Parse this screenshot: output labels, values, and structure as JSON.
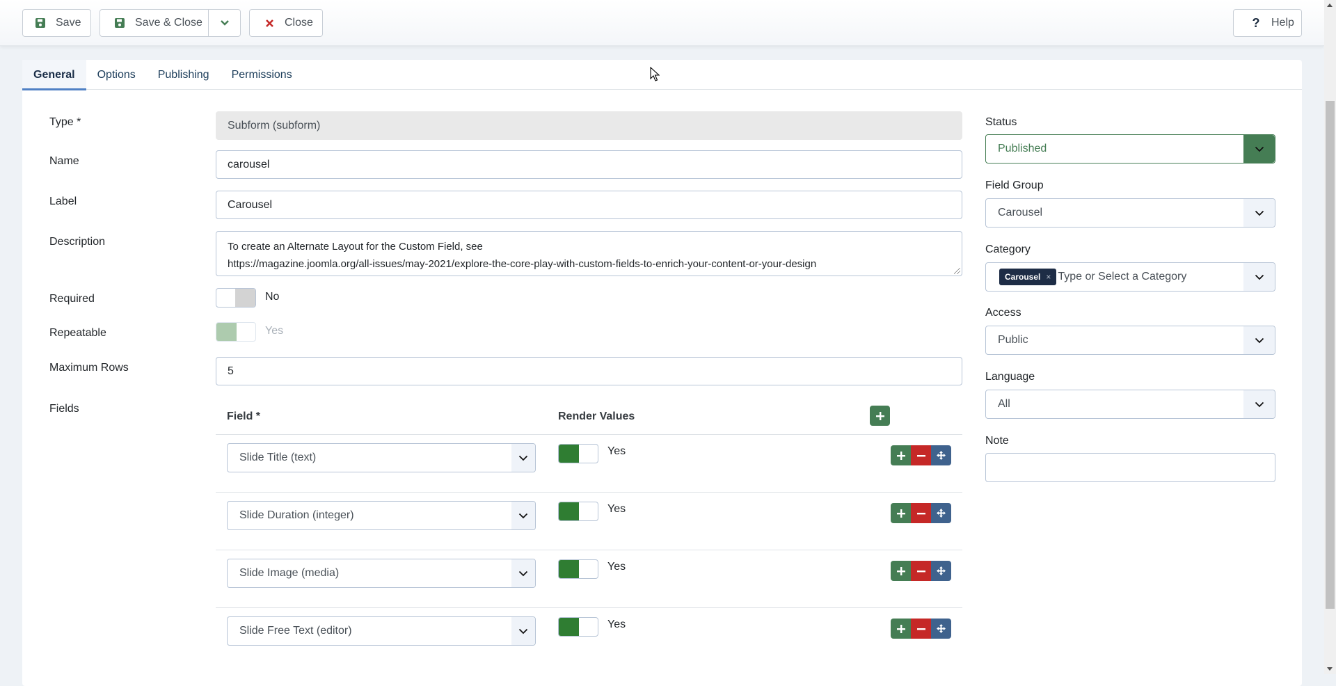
{
  "toolbar": {
    "save_label": "Save",
    "save_close_label": "Save & Close",
    "close_label": "Close",
    "help_label": "Help"
  },
  "tabs": [
    {
      "label": "General",
      "active": true
    },
    {
      "label": "Options",
      "active": false
    },
    {
      "label": "Publishing",
      "active": false
    },
    {
      "label": "Permissions",
      "active": false
    }
  ],
  "form": {
    "type": {
      "label": "Type *",
      "value": "Subform (subform)"
    },
    "name": {
      "label": "Name",
      "value": "carousel"
    },
    "field_label": {
      "label": "Label",
      "value": "Carousel"
    },
    "description": {
      "label": "Description",
      "line1": "To create an Alternate Layout for the Custom Field, see",
      "line2": "https://magazine.joomla.org/all-issues/may-2021/explore-the-core-play-with-custom-fields-to-enrich-your-content-or-your-design"
    },
    "required": {
      "label": "Required",
      "value": "No",
      "on": false
    },
    "repeatable": {
      "label": "Repeatable",
      "value": "Yes",
      "on": true,
      "disabled": true
    },
    "max_rows": {
      "label": "Maximum Rows",
      "value": "5"
    },
    "fields": {
      "label": "Fields",
      "col_field": "Field *",
      "col_render": "Render Values",
      "rows": [
        {
          "field": "Slide Title (text)",
          "render": "Yes"
        },
        {
          "field": "Slide Duration (integer)",
          "render": "Yes"
        },
        {
          "field": "Slide Image (media)",
          "render": "Yes"
        },
        {
          "field": "Slide Free Text (editor)",
          "render": "Yes"
        }
      ]
    }
  },
  "sidebar": {
    "status": {
      "label": "Status",
      "value": "Published"
    },
    "field_group": {
      "label": "Field Group",
      "value": "Carousel"
    },
    "category": {
      "label": "Category",
      "chip": "Carousel",
      "chip_remove": "×",
      "placeholder": "Type or Select a Category"
    },
    "access": {
      "label": "Access",
      "value": "Public"
    },
    "language": {
      "label": "Language",
      "value": "All"
    },
    "note": {
      "label": "Note",
      "value": ""
    }
  },
  "colors": {
    "success": "#457d54",
    "danger": "#c52827",
    "primary": "#3f628d",
    "switch_on": "#2f7d32",
    "tab_accent": "#4f80c4",
    "chip": "#1e2d46"
  }
}
